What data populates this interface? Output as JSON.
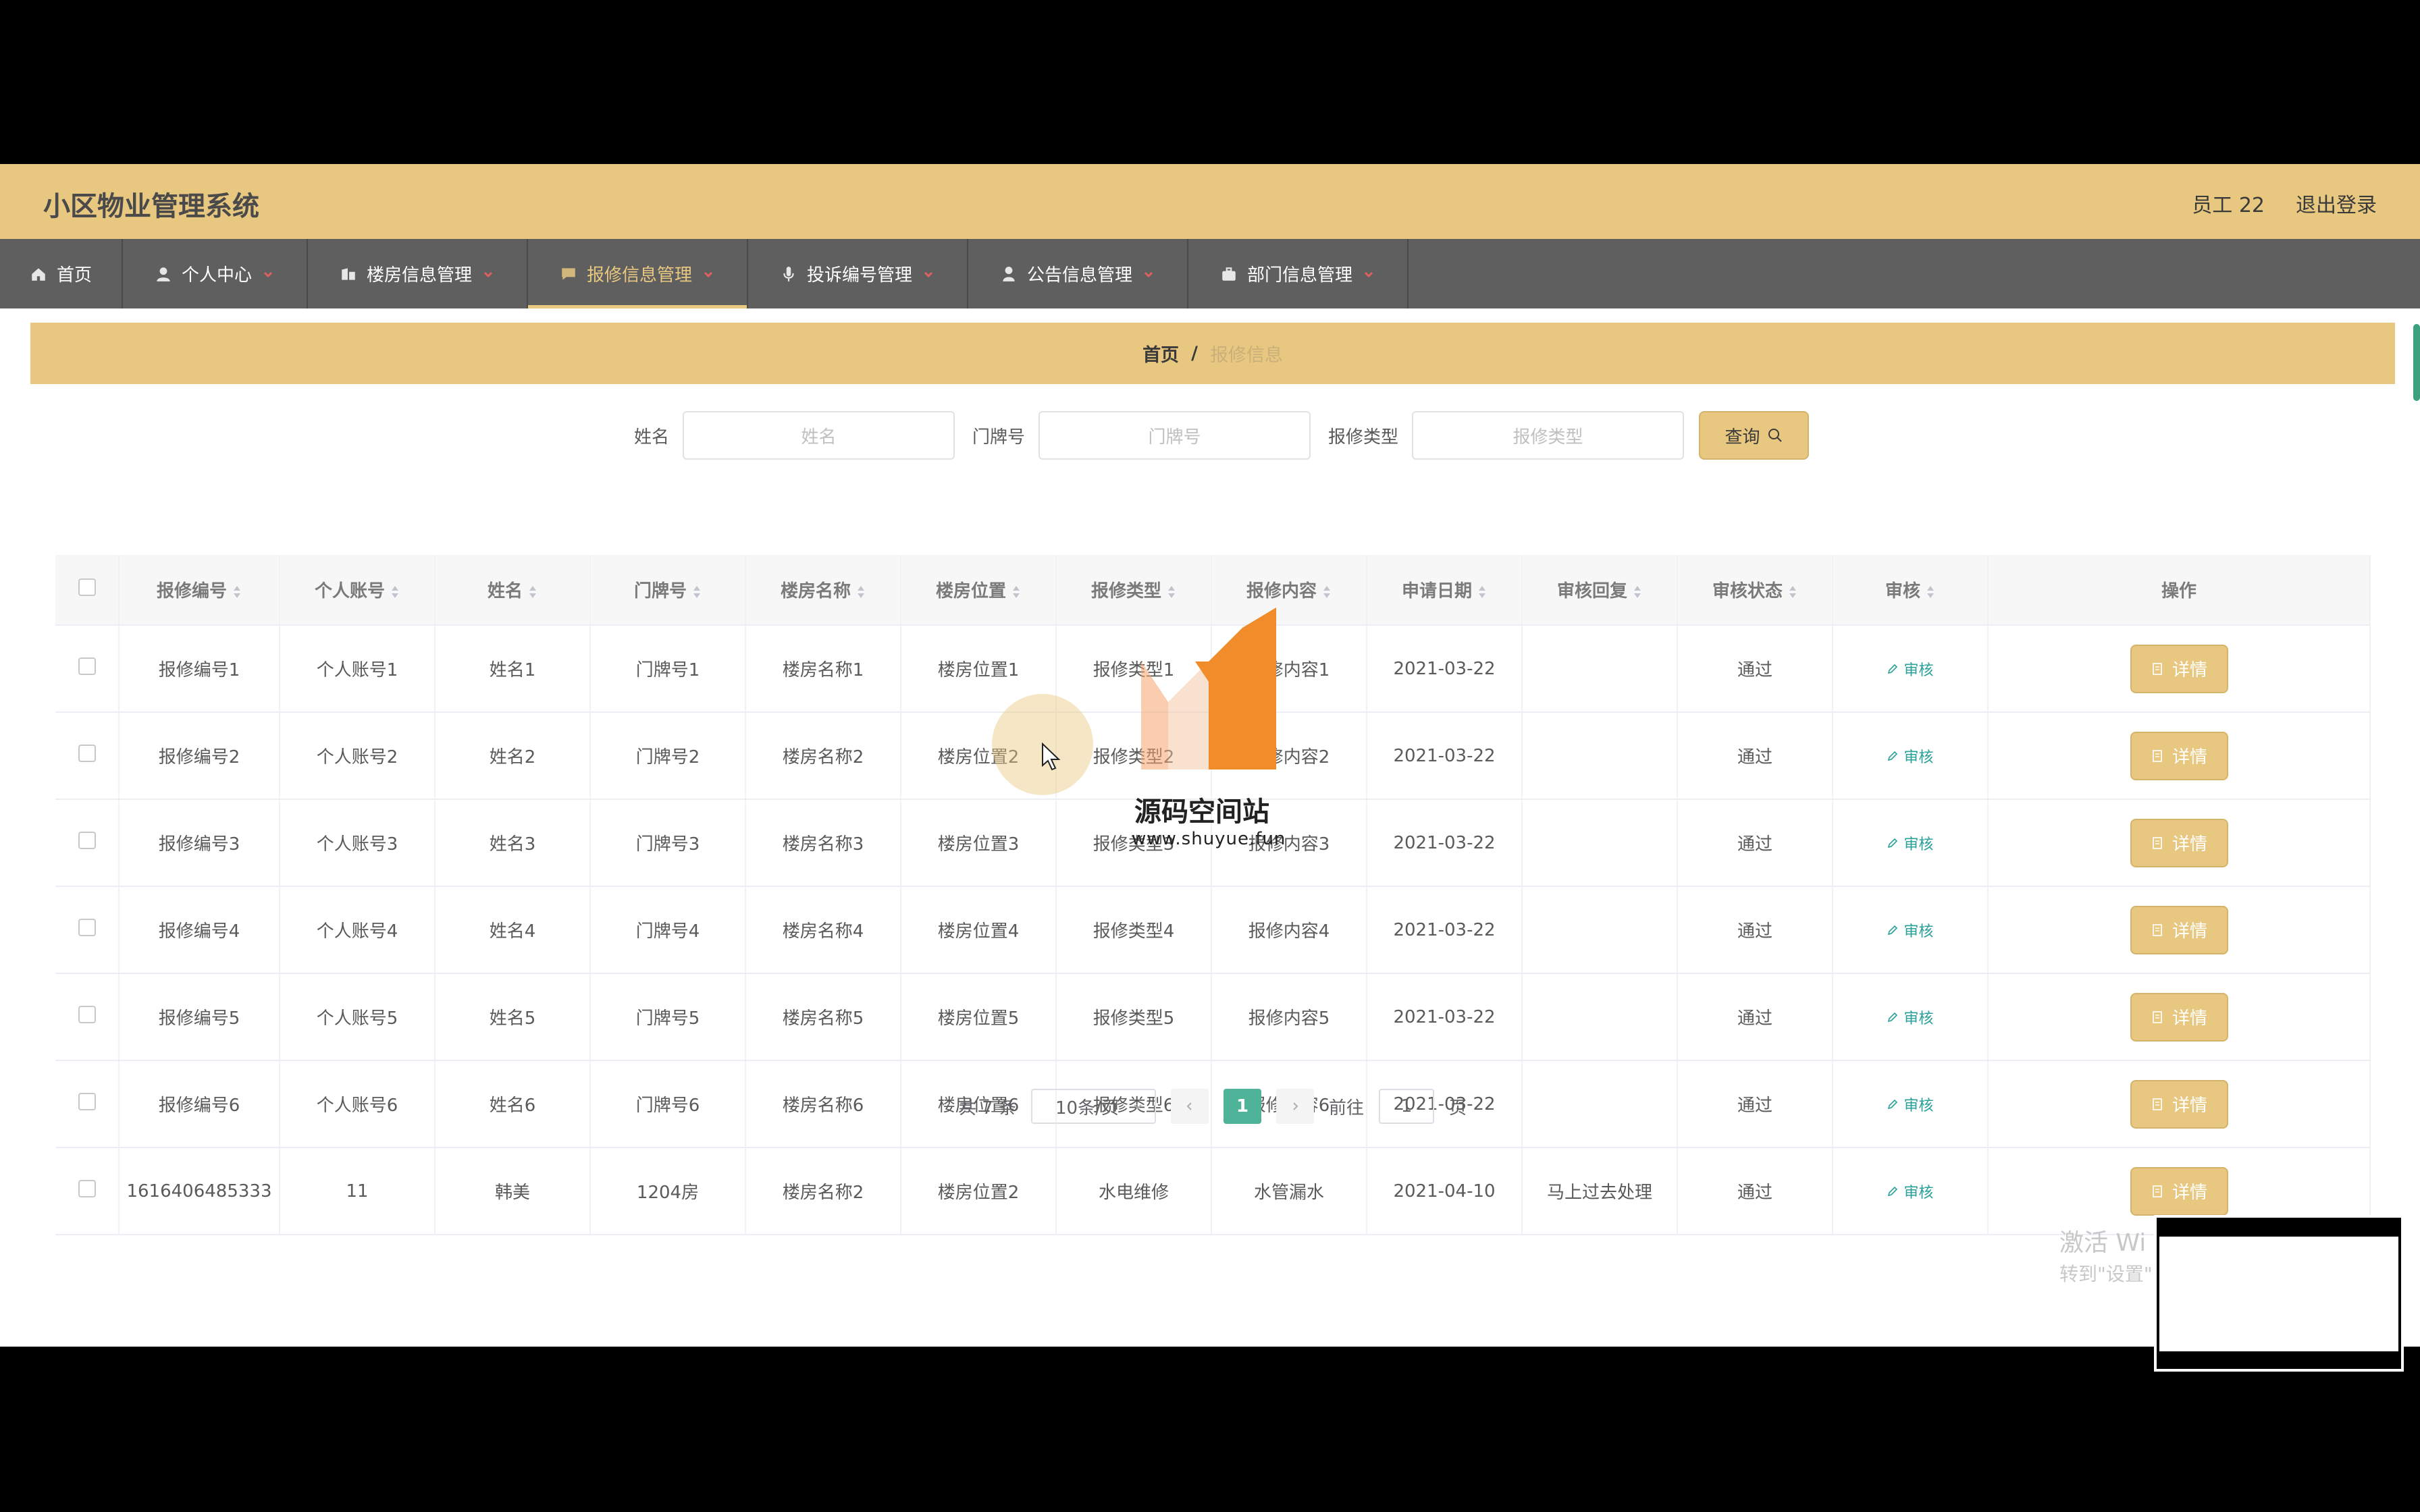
{
  "header": {
    "app_title": "小区物业管理系统",
    "user_label": "员工 22",
    "logout": "退出登录"
  },
  "nav": [
    {
      "label": "首页",
      "icon": "home-icon"
    },
    {
      "label": "个人中心",
      "icon": "user-icon"
    },
    {
      "label": "楼房信息管理",
      "icon": "building-icon"
    },
    {
      "label": "报修信息管理",
      "icon": "message-icon",
      "active": true
    },
    {
      "label": "投诉编号管理",
      "icon": "microphone-icon"
    },
    {
      "label": "公告信息管理",
      "icon": "person-icon"
    },
    {
      "label": "部门信息管理",
      "icon": "briefcase-icon"
    }
  ],
  "breadcrumb": {
    "home": "首页",
    "sep": "/",
    "current": "报修信息"
  },
  "search": {
    "name_label": "姓名",
    "name_placeholder": "姓名",
    "door_label": "门牌号",
    "door_placeholder": "门牌号",
    "type_label": "报修类型",
    "type_placeholder": "报修类型",
    "query_label": "查询"
  },
  "table": {
    "headers": [
      "报修编号",
      "个人账号",
      "姓名",
      "门牌号",
      "楼房名称",
      "楼房位置",
      "报修类型",
      "报修内容",
      "申请日期",
      "审核回复",
      "审核状态",
      "审核",
      "操作"
    ],
    "audit_label": "审核",
    "detail_label": "详情",
    "rows": [
      [
        "报修编号1",
        "个人账号1",
        "姓名1",
        "门牌号1",
        "楼房名称1",
        "楼房位置1",
        "报修类型1",
        "报修内容1",
        "2021-03-22",
        "",
        "通过"
      ],
      [
        "报修编号2",
        "个人账号2",
        "姓名2",
        "门牌号2",
        "楼房名称2",
        "楼房位置2",
        "报修类型2",
        "报修内容2",
        "2021-03-22",
        "",
        "通过"
      ],
      [
        "报修编号3",
        "个人账号3",
        "姓名3",
        "门牌号3",
        "楼房名称3",
        "楼房位置3",
        "报修类型3",
        "报修内容3",
        "2021-03-22",
        "",
        "通过"
      ],
      [
        "报修编号4",
        "个人账号4",
        "姓名4",
        "门牌号4",
        "楼房名称4",
        "楼房位置4",
        "报修类型4",
        "报修内容4",
        "2021-03-22",
        "",
        "通过"
      ],
      [
        "报修编号5",
        "个人账号5",
        "姓名5",
        "门牌号5",
        "楼房名称5",
        "楼房位置5",
        "报修类型5",
        "报修内容5",
        "2021-03-22",
        "",
        "通过"
      ],
      [
        "报修编号6",
        "个人账号6",
        "姓名6",
        "门牌号6",
        "楼房名称6",
        "楼房位置6",
        "报修类型6",
        "报修内容6",
        "2021-03-22",
        "",
        "通过"
      ],
      [
        "1616406485333",
        "11",
        "韩美",
        "1204房",
        "楼房名称2",
        "楼房位置2",
        "水电维修",
        "水管漏水",
        "2021-04-10",
        "马上过去处理",
        "通过"
      ]
    ]
  },
  "pagination": {
    "total": "共 7 条",
    "page_size": "10条/页",
    "current_page": "1",
    "goto_prefix": "前往",
    "goto_value": "1",
    "goto_suffix": "页"
  },
  "watermark": {
    "name": "源码空间站",
    "url": "www.shuyue.fun"
  },
  "os_overlay": {
    "line1": "激活 Wi",
    "line2": "转到\"设置\""
  }
}
